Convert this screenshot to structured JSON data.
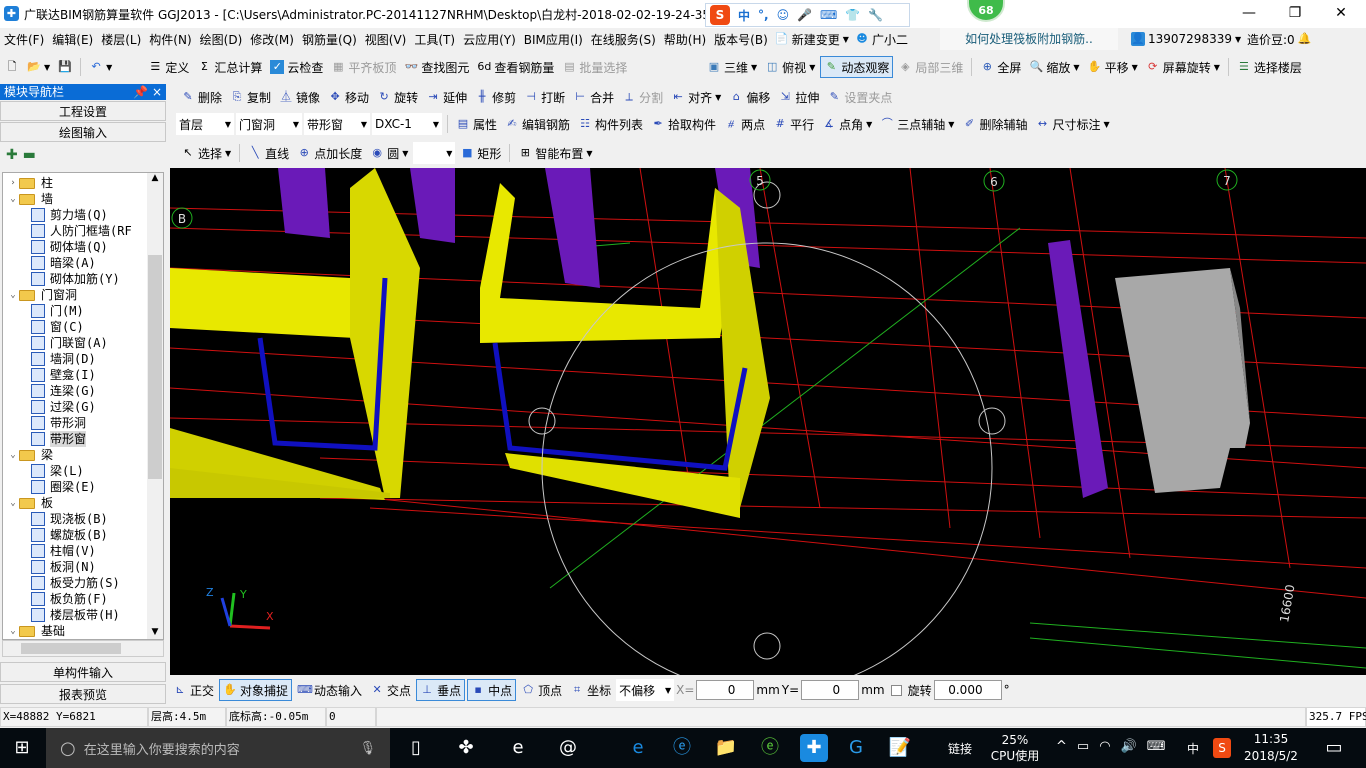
{
  "window": {
    "title": "广联达BIM钢筋算量软件 GGJ2013 - [C:\\Users\\Administrator.PC-20141127NRHM\\Desktop\\白龙村-2018-02-02-19-24-35",
    "badge": "68",
    "ime_label": "中"
  },
  "menu": [
    "文件(F)",
    "编辑(E)",
    "楼层(L)",
    "构件(N)",
    "绘图(D)",
    "修改(M)",
    "钢筋量(Q)",
    "视图(V)",
    "工具(T)",
    "云应用(Y)",
    "BIM应用(I)",
    "在线服务(S)",
    "帮助(H)",
    "版本号(B)"
  ],
  "menu_extra": {
    "new_change": "新建变更",
    "assistant": "广小二",
    "tip": "如何处理筏板附加钢筋..",
    "phone": "13907298339",
    "beans": "造价豆:0"
  },
  "toolbar1": {
    "items": [
      "定义",
      "汇总计算",
      "云检查",
      "平齐板顶",
      "查找图元",
      "查看钢筋量",
      "批量选择"
    ],
    "disabled": [
      "平齐板顶",
      "批量选择"
    ],
    "view_items": [
      "三维",
      "俯视",
      "动态观察",
      "局部三维",
      "全屏",
      "缩放",
      "平移",
      "屏幕旋转",
      "选择楼层"
    ],
    "active": "动态观察"
  },
  "sidebar": {
    "title": "模块导航栏",
    "buttons": [
      "工程设置",
      "绘图输入"
    ],
    "bottom_buttons": [
      "单构件输入",
      "报表预览"
    ],
    "tree": [
      {
        "label": "柱",
        "level": 0,
        "expanded": false
      },
      {
        "label": "墙",
        "level": 0,
        "expanded": true
      },
      {
        "label": "剪力墙(Q)",
        "level": 1
      },
      {
        "label": "人防门框墙(RF",
        "level": 1
      },
      {
        "label": "砌体墙(Q)",
        "level": 1
      },
      {
        "label": "暗梁(A)",
        "level": 1
      },
      {
        "label": "砌体加筋(Y)",
        "level": 1
      },
      {
        "label": "门窗洞",
        "level": 0,
        "expanded": true
      },
      {
        "label": "门(M)",
        "level": 1
      },
      {
        "label": "窗(C)",
        "level": 1
      },
      {
        "label": "门联窗(A)",
        "level": 1
      },
      {
        "label": "墙洞(D)",
        "level": 1
      },
      {
        "label": "壁龛(I)",
        "level": 1
      },
      {
        "label": "连梁(G)",
        "level": 1
      },
      {
        "label": "过梁(G)",
        "level": 1
      },
      {
        "label": "带形洞",
        "level": 1
      },
      {
        "label": "带形窗",
        "level": 1,
        "selected": true
      },
      {
        "label": "梁",
        "level": 0,
        "expanded": true
      },
      {
        "label": "梁(L)",
        "level": 1
      },
      {
        "label": "圈梁(E)",
        "level": 1
      },
      {
        "label": "板",
        "level": 0,
        "expanded": true
      },
      {
        "label": "现浇板(B)",
        "level": 1
      },
      {
        "label": "螺旋板(B)",
        "level": 1
      },
      {
        "label": "柱帽(V)",
        "level": 1
      },
      {
        "label": "板洞(N)",
        "level": 1
      },
      {
        "label": "板受力筋(S)",
        "level": 1
      },
      {
        "label": "板负筋(F)",
        "level": 1
      },
      {
        "label": "楼层板带(H)",
        "level": 1
      },
      {
        "label": "基础",
        "level": 0,
        "expanded": true
      }
    ]
  },
  "edit_toolbar": [
    "删除",
    "复制",
    "镜像",
    "移动",
    "旋转",
    "延伸",
    "修剪",
    "打断",
    "合并",
    "分割",
    "对齐",
    "偏移",
    "拉伸",
    "设置夹点"
  ],
  "edit_disabled": [
    "分割",
    "设置夹点"
  ],
  "selectors": {
    "floor": "首层",
    "category": "门窗洞",
    "type": "带形窗",
    "component": "DXC-1"
  },
  "prop_toolbar": [
    "属性",
    "编辑钢筋",
    "构件列表",
    "拾取构件",
    "两点",
    "平行",
    "点角",
    "三点辅轴",
    "删除辅轴",
    "尺寸标注"
  ],
  "draw_toolbar": [
    "选择",
    "直线",
    "点加长度",
    "圆",
    "矩形",
    "智能布置"
  ],
  "viewport": {
    "axis_labels": [
      "B",
      "5",
      "6",
      "7"
    ],
    "dimension": "16600",
    "axes": {
      "x": "X",
      "y": "Y",
      "z": "Z"
    }
  },
  "snap_toolbar": {
    "items": [
      "正交",
      "对象捕捉",
      "动态输入",
      "交点",
      "垂点",
      "中点",
      "顶点",
      "坐标"
    ],
    "active": [
      "对象捕捉",
      "垂点",
      "中点"
    ],
    "offset": "不偏移",
    "x_label": "X=",
    "x": "0",
    "y_label": "Y=",
    "y": "0",
    "unit": "mm",
    "rotate_label": "旋转",
    "rotate": "0.000",
    "deg": "°"
  },
  "status": {
    "coords": "X=48882 Y=6821",
    "floor_height": "层高:4.5m",
    "base_elev": "底标高:-0.05m",
    "value": "0",
    "fps": "325.7 FPS"
  },
  "taskbar": {
    "search_placeholder": "在这里输入你要搜索的内容",
    "link": "链接",
    "cpu": "25%",
    "cpu_label": "CPU使用",
    "ime": "中",
    "time": "11:35",
    "date": "2018/5/2"
  }
}
